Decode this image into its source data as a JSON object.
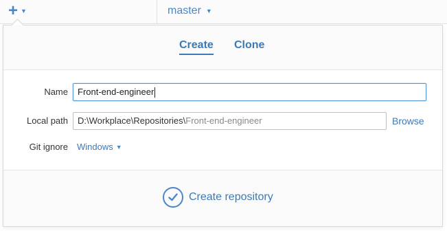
{
  "toolbar": {
    "add_icon": "plus-icon",
    "branch": {
      "label": "master"
    }
  },
  "tabs": [
    {
      "label": "Create",
      "active": true
    },
    {
      "label": "Clone",
      "active": false
    }
  ],
  "form": {
    "name": {
      "label": "Name",
      "value": "Front-end-engineer"
    },
    "local_path": {
      "label": "Local path",
      "value_prefix": "D:\\Workplace\\Repositories\\",
      "value_suffix": "Front-end-engineer",
      "browse_label": "Browse"
    },
    "git_ignore": {
      "label": "Git ignore",
      "selected": "Windows"
    }
  },
  "footer": {
    "action_label": "Create repository",
    "action_icon": "checkmark-circle-icon"
  },
  "colors": {
    "accent": "#3c79b8",
    "border": "#d8d8d8",
    "focus": "#5b9bd5"
  }
}
